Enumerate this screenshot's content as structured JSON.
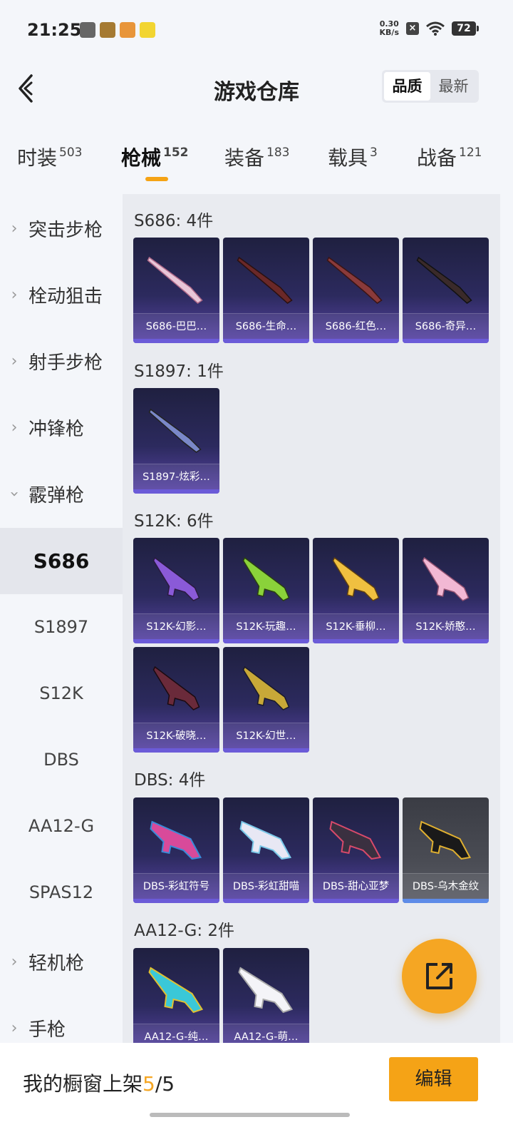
{
  "status_bar": {
    "time": "21:25",
    "net_speed_value": "0.30",
    "net_speed_unit": "KB/s",
    "battery": "72"
  },
  "header": {
    "title": "游戏仓库",
    "sort_options": [
      "品质",
      "最新"
    ],
    "sort_selected": "品质"
  },
  "tabs": [
    {
      "label": "时装",
      "count": "503"
    },
    {
      "label": "枪械",
      "count": "152"
    },
    {
      "label": "装备",
      "count": "183"
    },
    {
      "label": "载具",
      "count": "3"
    },
    {
      "label": "战备",
      "count": "121"
    }
  ],
  "active_tab": "枪械",
  "sidebar": {
    "categories": [
      "突击步枪",
      "栓动狙击",
      "射手步枪",
      "冲锋枪",
      "霰弹枪",
      "轻机枪",
      "手枪"
    ],
    "expanded_category": "霰弹枪",
    "subcategories": [
      "S686",
      "S1897",
      "S12K",
      "DBS",
      "AA12-G",
      "SPAS12"
    ],
    "selected_subcategory": "S686"
  },
  "groups": [
    {
      "title": "S686: 4件",
      "items": [
        "S686-巴巴…",
        "S686-生命…",
        "S686-红色…",
        "S686-奇异…"
      ]
    },
    {
      "title": "S1897: 1件",
      "items": [
        "S1897-炫彩…"
      ]
    },
    {
      "title": "S12K: 6件",
      "items": [
        "S12K-幻影…",
        "S12K-玩趣…",
        "S12K-垂柳…",
        "S12K-娇憨…",
        "S12K-破晓…",
        "S12K-幻世…"
      ]
    },
    {
      "title": "DBS: 4件",
      "items": [
        "DBS-彩虹符号",
        "DBS-彩虹甜喵",
        "DBS-甜心亚梦",
        "DBS-乌木金纹"
      ]
    },
    {
      "title": "AA12-G: 2件",
      "items": [
        "AA12-G-纯…",
        "AA12-G-萌…"
      ]
    }
  ],
  "bottom": {
    "showcase_prefix": "我的橱窗上架",
    "showcase_current": "5",
    "showcase_total": "/5",
    "edit_label": "编辑"
  },
  "colors": {
    "accent": "#f5a316",
    "card_bg": "#2c2a5e",
    "card_bar": "#6b5bd8"
  },
  "icons": [
    "back-arrow-icon",
    "chevron-right-icon",
    "chevron-down-icon",
    "share-external-icon",
    "wifi-icon",
    "battery-icon"
  ]
}
